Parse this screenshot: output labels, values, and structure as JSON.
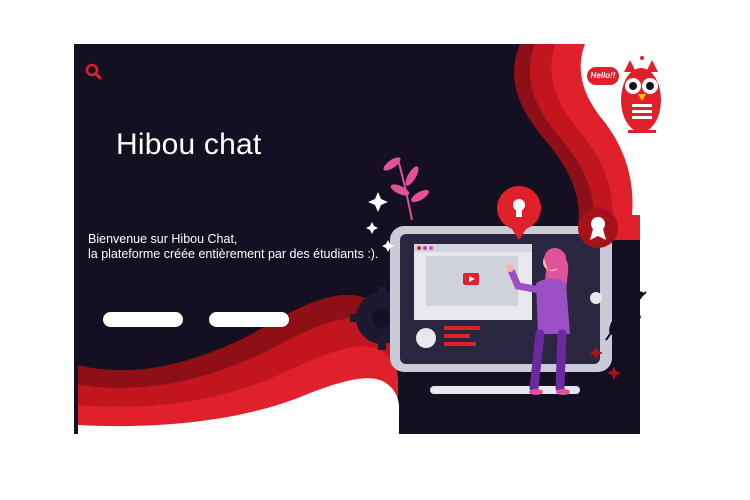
{
  "header": {
    "search_icon": "search-icon",
    "logo_badge_text": "Hello!!"
  },
  "hero": {
    "title": "Hibou chat",
    "welcome_line1": "Bienvenue sur Hibou Chat,",
    "welcome_line2": "la plateforme créée entièrement par des étudiants :).",
    "buttons": [
      {
        "label": ""
      },
      {
        "label": ""
      }
    ]
  },
  "illustration": {
    "icons": [
      "owl-logo-icon",
      "lightbulb-icon",
      "award-badge-icon",
      "play-icon",
      "gear-icon",
      "sparkle-icon",
      "leaf-icon"
    ]
  },
  "colors": {
    "background_dark": "#141022",
    "accent_red": "#e0202a",
    "accent_dark_red": "#a5121c",
    "accent_purple": "#9b4fc5",
    "accent_pink": "#e0529a"
  }
}
